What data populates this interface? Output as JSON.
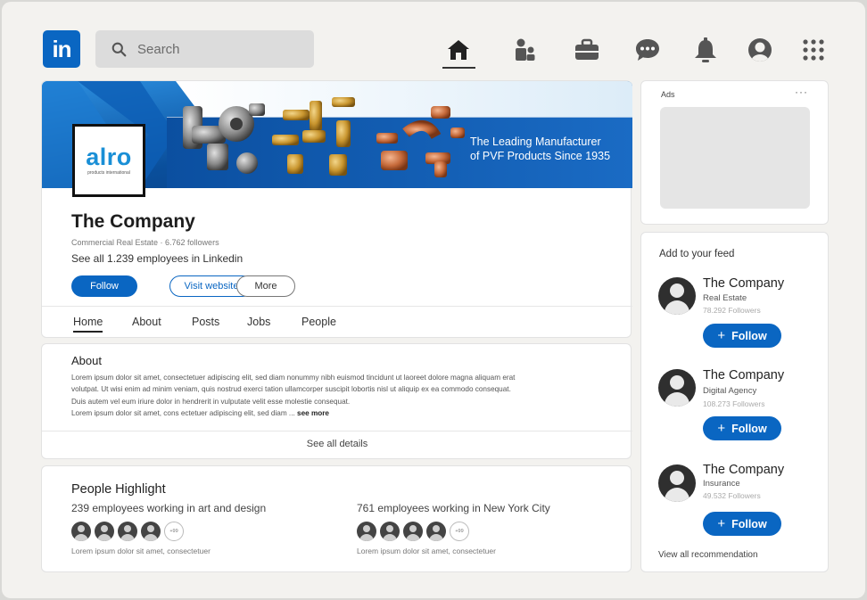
{
  "nav": {
    "logo_text": "in",
    "search_placeholder": "Search",
    "icons": [
      "home-icon",
      "people-icon",
      "briefcase-icon",
      "messaging-icon",
      "bell-icon",
      "profile-icon",
      "grid-icon"
    ]
  },
  "company": {
    "banner_line1": "The Leading Manufacturer",
    "banner_line2": "of PVF Products Since 1935",
    "logo_word": "alro",
    "logo_sub": "products international",
    "name": "The Company",
    "meta": "Commercial Real Estate · 6.762 followers",
    "employees": "See all 1.239 employees in Linkedin",
    "buttons": {
      "follow": "Follow",
      "visit": "Visit website",
      "more": "More"
    },
    "tabs": [
      "Home",
      "About",
      "Posts",
      "Jobs",
      "People"
    ]
  },
  "about": {
    "title": "About",
    "line1": "Lorem ipsum dolor sit amet, consectetuer adipiscing elit, sed diam nonummy nibh euismod tincidunt ut laoreet dolore magna aliquam erat",
    "line2": "volutpat. Ut wisi enim ad minim veniam, quis nostrud exerci tation ullamcorper suscipit lobortis nisl ut aliquip ex ea commodo consequat.",
    "line3": "Duis autem vel eum iriure dolor in hendrerit in vulputate velit esse molestie consequat.",
    "line4": "Lorem ipsum dolor sit amet, cons ectetuer adipiscing elit, sed diam ...",
    "see_more": "see more",
    "see_all": "See all details"
  },
  "people": {
    "title": "People Highlight",
    "groups": [
      {
        "text": "239 employees working in art and design",
        "more": "+99",
        "caption": "Lorem ipsum dolor sit amet, consectetuer"
      },
      {
        "text": "761 employees working in New York City",
        "more": "+99",
        "caption": "Lorem ipsum dolor sit amet, consectetuer"
      }
    ]
  },
  "ads": {
    "label": "Ads",
    "dots": "···"
  },
  "feed": {
    "title": "Add to your feed",
    "items": [
      {
        "name": "The Company",
        "category": "Real Estate",
        "followers": "78.292 Followers",
        "button": "Follow"
      },
      {
        "name": "The Company",
        "category": "Digital Agency",
        "followers": "108.273 Followers",
        "button": "Follow"
      },
      {
        "name": "The Company",
        "category": "Insurance",
        "followers": "49.532 Followers",
        "button": "Follow"
      }
    ],
    "view_all": "View all recommendation"
  },
  "colors": {
    "brand": "#0a66c2",
    "background": "#f3f2ef"
  }
}
